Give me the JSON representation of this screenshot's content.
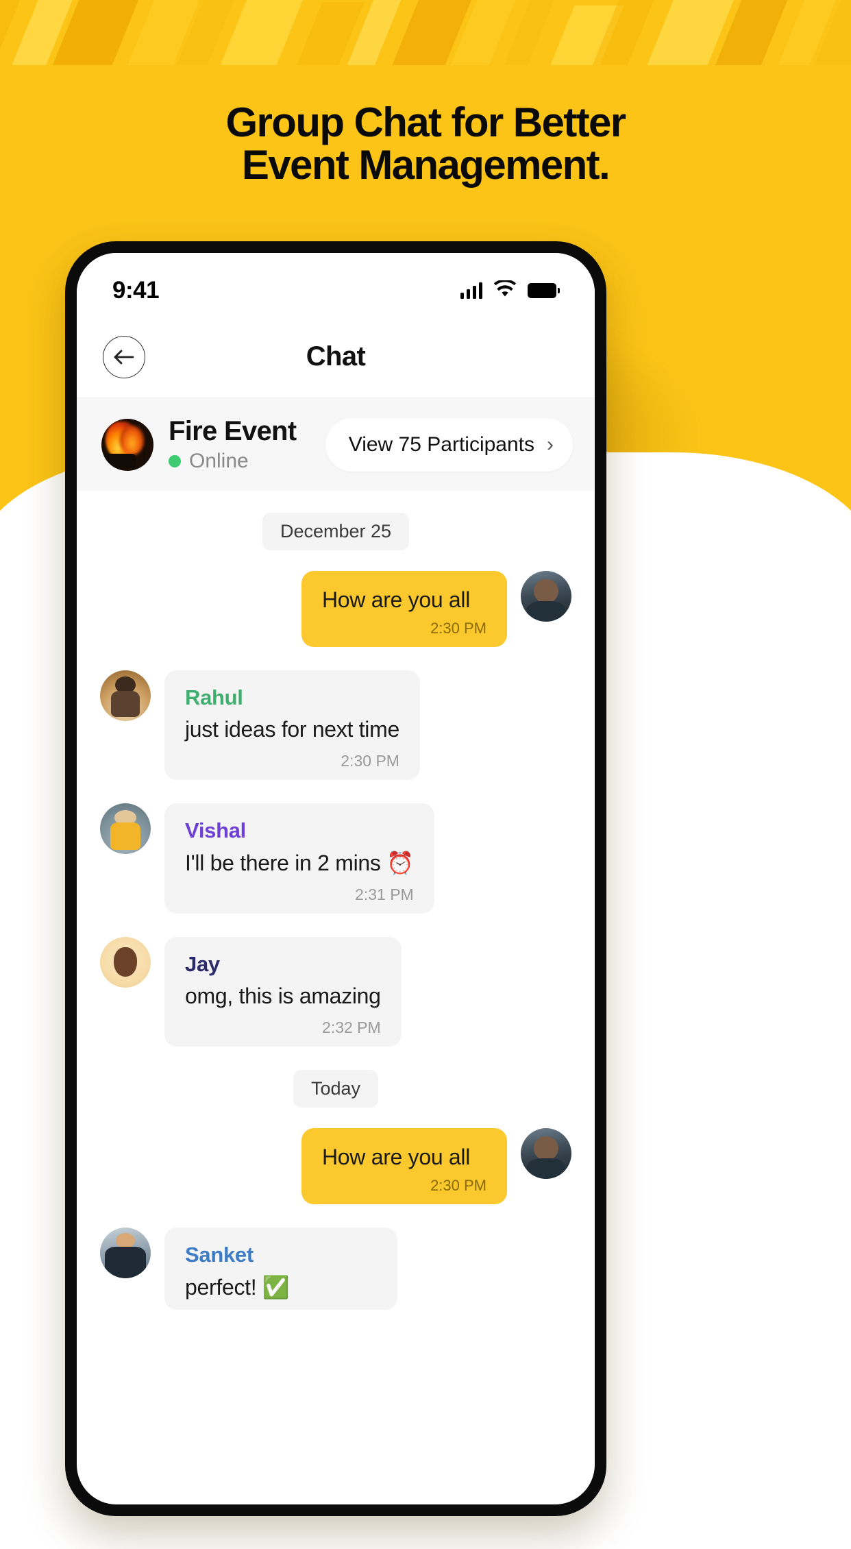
{
  "brand": {
    "accent": "#FBC417",
    "bubble_yellow": "#FBC92E",
    "online_green": "#3FCB72"
  },
  "headline": {
    "line1": "Group Chat for Better",
    "line2": "Event Management."
  },
  "phone": {
    "statusbar": {
      "time": "9:41",
      "signal_icon": "signal-bars-icon",
      "wifi_icon": "wifi-icon",
      "battery_icon": "battery-full-icon"
    },
    "header": {
      "title": "Chat",
      "back_icon": "arrow-left-icon"
    },
    "group": {
      "avatar_icon": "fire-event-avatar",
      "name": "Fire Event",
      "status": "Online",
      "participants_label": "View 75 Participants",
      "chevron": "›"
    },
    "messages": {
      "divider_1": "December 25",
      "divider_2": "Today",
      "items": [
        {
          "kind": "out",
          "text": "How are you all",
          "time": "2:30 PM",
          "avatar": "self-avatar"
        },
        {
          "kind": "in",
          "who": "Rahul",
          "who_color": "#3FAE6E",
          "text": "just ideas for next time",
          "time": "2:30 PM",
          "avatar": "rahul-avatar"
        },
        {
          "kind": "in",
          "who": "Vishal",
          "who_color": "#6D3FD4",
          "text": "I'll be there in 2 mins ⏰",
          "time": "2:31 PM",
          "avatar": "vishal-avatar"
        },
        {
          "kind": "in",
          "who": "Jay",
          "who_color": "#2B2A6B",
          "text": "omg, this is amazing",
          "time": "2:32 PM",
          "avatar": "jay-avatar"
        },
        {
          "kind": "out",
          "text": "How are you all",
          "time": "2:30 PM",
          "avatar": "self-avatar"
        },
        {
          "kind": "in",
          "who": "Sanket",
          "who_color": "#3B7CC4",
          "text": "perfect! ✅",
          "time": "",
          "avatar": "sanket-avatar"
        }
      ]
    }
  }
}
